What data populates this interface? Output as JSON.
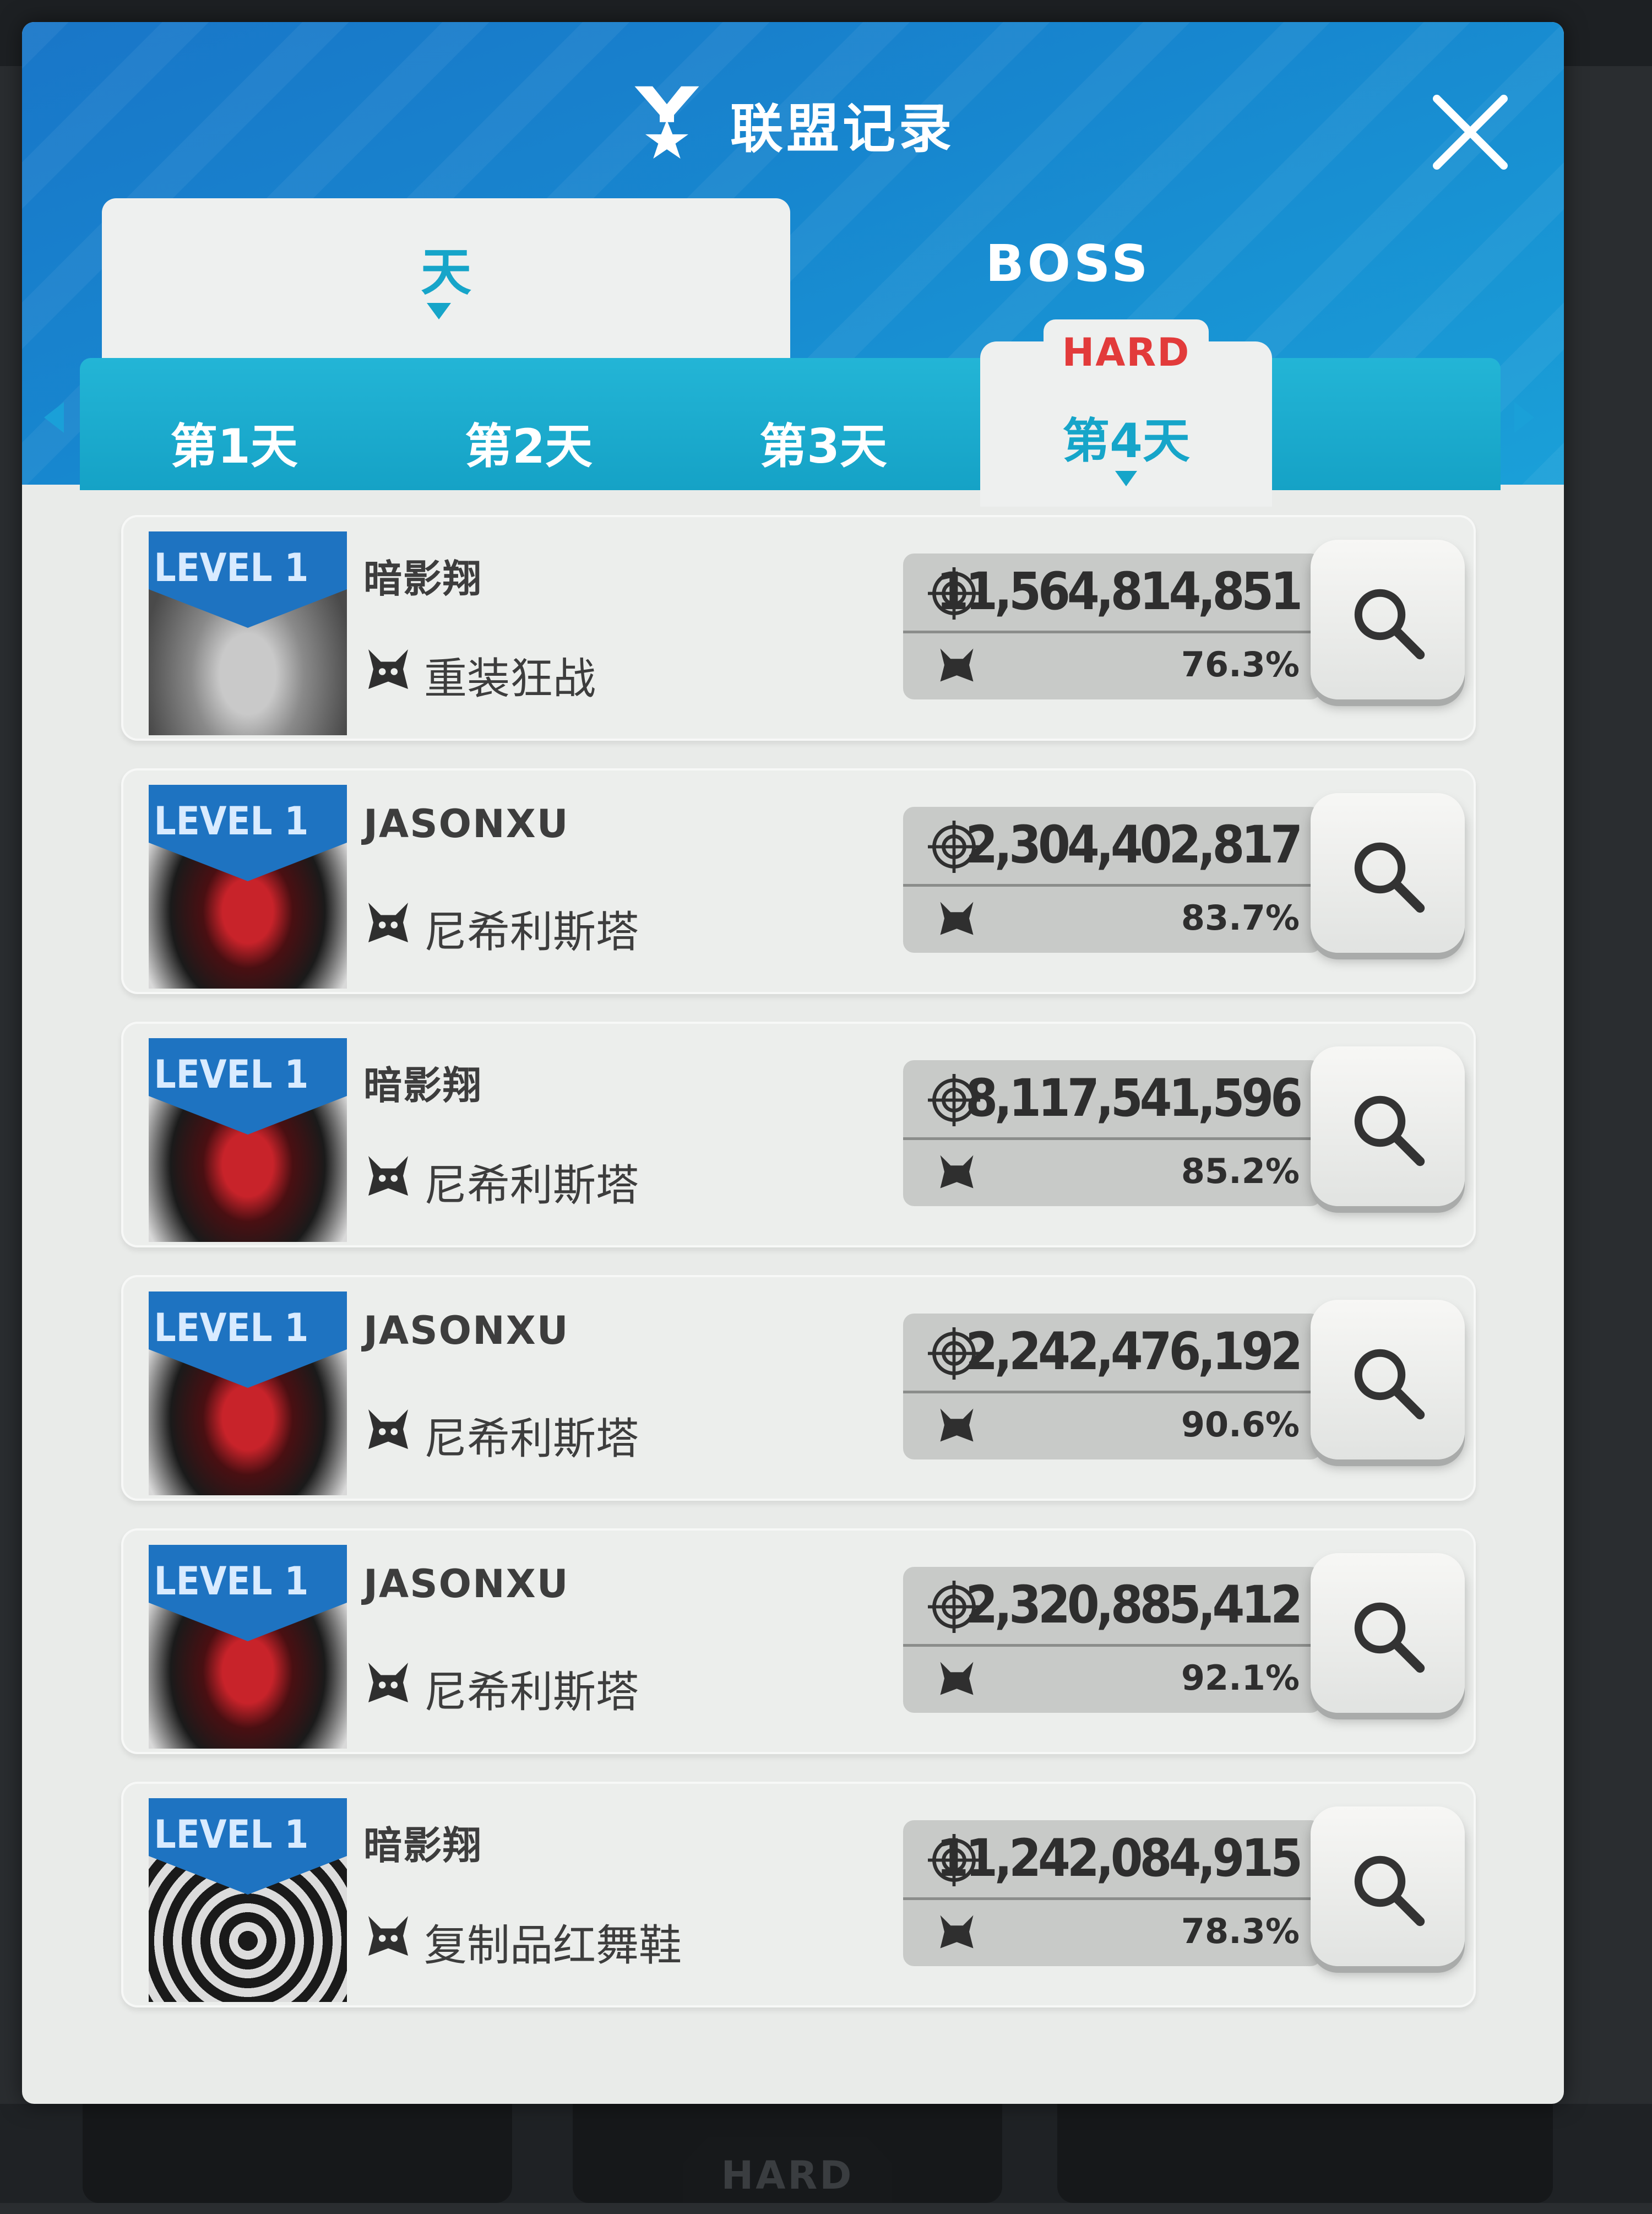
{
  "window": {
    "title": "联盟记录"
  },
  "category_tabs": [
    {
      "label": "天",
      "active": true
    },
    {
      "label": "BOSS",
      "active": false
    }
  ],
  "difficulty_badge": "HARD",
  "day_tabs": [
    {
      "label": "第1天",
      "active": false
    },
    {
      "label": "第2天",
      "active": false
    },
    {
      "label": "第3天",
      "active": false
    },
    {
      "label": "第4天",
      "active": true
    }
  ],
  "records": [
    {
      "level": "LEVEL 1",
      "player": "暗影翔",
      "boss": "重装狂战",
      "damage": "11,564,814,851",
      "percent": "76.3%"
    },
    {
      "level": "LEVEL 1",
      "player": "JASONXU",
      "boss": "尼希利斯塔",
      "damage": "2,304,402,817",
      "percent": "83.7%"
    },
    {
      "level": "LEVEL 1",
      "player": "暗影翔",
      "boss": "尼希利斯塔",
      "damage": "8,117,541,596",
      "percent": "85.2%"
    },
    {
      "level": "LEVEL 1",
      "player": "JASONXU",
      "boss": "尼希利斯塔",
      "damage": "2,242,476,192",
      "percent": "90.6%"
    },
    {
      "level": "LEVEL 1",
      "player": "JASONXU",
      "boss": "尼希利斯塔",
      "damage": "2,320,885,412",
      "percent": "92.1%"
    },
    {
      "level": "LEVEL 1",
      "player": "暗影翔",
      "boss": "复制品红舞鞋",
      "damage": "11,242,084,915",
      "percent": "78.3%"
    }
  ],
  "background_tab_label": "HARD",
  "colors": {
    "header_blue": "#1787cf",
    "tab_cyan": "#16a5c9",
    "hard_red": "#e23b3b",
    "level_ribbon": "#1e73c1"
  }
}
